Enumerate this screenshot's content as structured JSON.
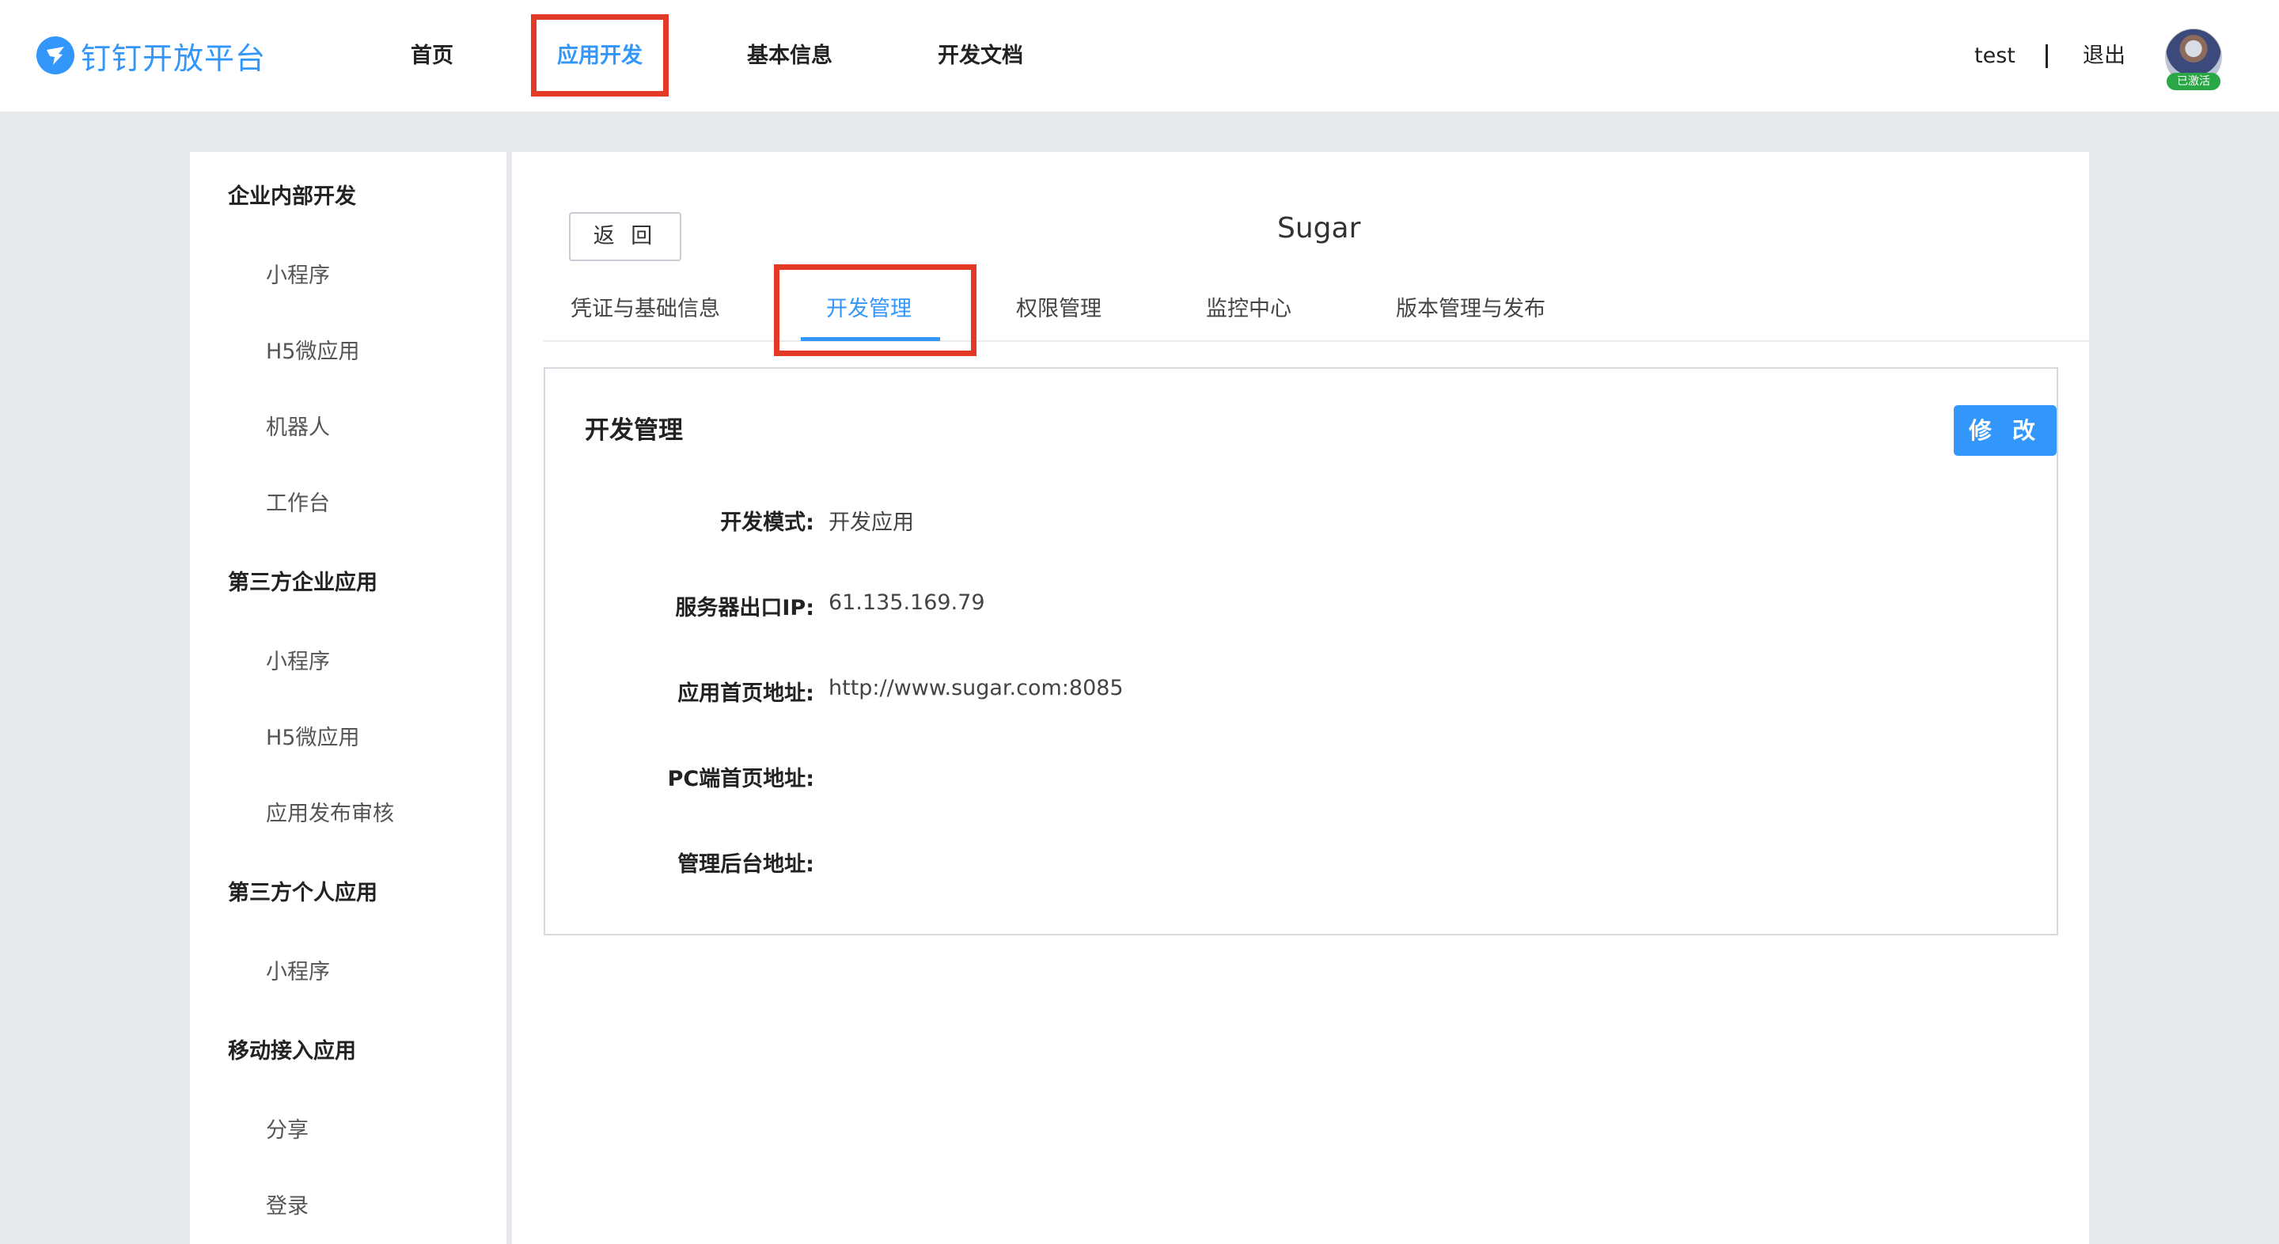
{
  "header": {
    "logo_text": "钉钉开放平台",
    "nav": [
      "首页",
      "应用开发",
      "基本信息",
      "开发文档"
    ],
    "active_nav_index": 1,
    "username": "test",
    "separator": "|",
    "logout": "退出",
    "avatar_badge": "已激活"
  },
  "sidebar": {
    "groups": [
      {
        "title": "企业内部开发",
        "items": [
          "小程序",
          "H5微应用",
          "机器人",
          "工作台"
        ]
      },
      {
        "title": "第三方企业应用",
        "items": [
          "小程序",
          "H5微应用",
          "应用发布审核"
        ]
      },
      {
        "title": "第三方个人应用",
        "items": [
          "小程序"
        ]
      },
      {
        "title": "移动接入应用",
        "items": [
          "分享",
          "登录"
        ]
      }
    ]
  },
  "main": {
    "back_button": "返 回",
    "app_name": "Sugar",
    "tabs": [
      "凭证与基础信息",
      "开发管理",
      "权限管理",
      "监控中心",
      "版本管理与发布"
    ],
    "active_tab_index": 1,
    "section_title": "开发管理",
    "edit_button": "修 改",
    "fields": [
      {
        "label": "开发模式:",
        "value": "开发应用"
      },
      {
        "label": "服务器出口IP:",
        "value": "61.135.169.79"
      },
      {
        "label": "应用首页地址:",
        "value": "http://www.sugar.com:8085"
      },
      {
        "label": "PC端首页地址:",
        "value": ""
      },
      {
        "label": "管理后台地址:",
        "value": ""
      }
    ]
  },
  "colors": {
    "accent": "#3296fa",
    "highlight_box": "#e33a27",
    "badge": "#29a745",
    "page_bg": "#e8e9ec"
  }
}
